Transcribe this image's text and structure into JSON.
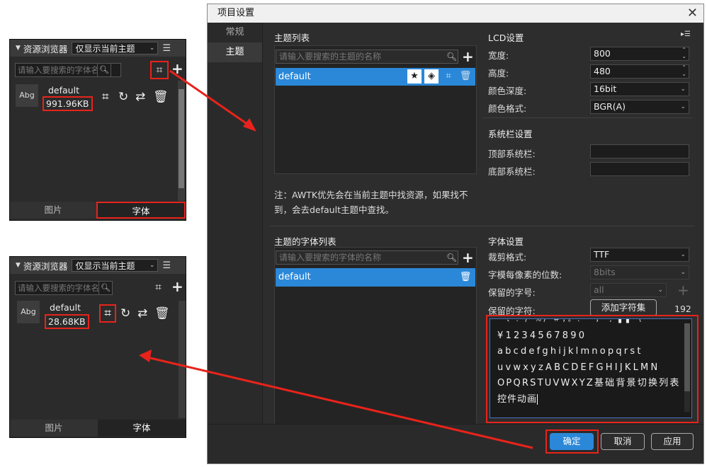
{
  "panel_top": {
    "title": "资源浏览器",
    "filter_select": "仅显示当前主题",
    "search_placeholder": "请输入要搜索的字体名称",
    "item": {
      "thumb": "Abg",
      "name": "default",
      "size": "991.96KB"
    },
    "tabs": [
      "图片",
      "字体"
    ],
    "active_tab": "字体"
  },
  "panel_bottom": {
    "title": "资源浏览器",
    "filter_select": "仅显示当前主题",
    "search_placeholder": "请输入要搜索的字体名称",
    "item": {
      "thumb": "Abg",
      "name": "default",
      "size": "28.68KB"
    },
    "tabs": [
      "图片",
      "字体"
    ],
    "active_tab": "字体"
  },
  "dialog": {
    "title": "项目设置",
    "nav": [
      "常规",
      "主题"
    ],
    "active_nav": "主题",
    "theme_list": {
      "title": "主题列表",
      "search_placeholder": "请输入要搜索的主题的名称",
      "items": [
        "default"
      ]
    },
    "note": "注：AWTK优先会在当前主题中找资源，如果找不到，会去default主题中查找。",
    "lcd": {
      "title": "LCD设置",
      "width_label": "宽度:",
      "width": "800",
      "height_label": "高度:",
      "height": "480",
      "depth_label": "颜色深度:",
      "depth": "16bit",
      "format_label": "颜色格式:",
      "format": "BGR(A)"
    },
    "system_bar": {
      "title": "系统栏设置",
      "top_label": "顶部系统栏:",
      "top": "",
      "bottom_label": "底部系统栏:",
      "bottom": ""
    },
    "font_list": {
      "title": "主题的字体列表",
      "search_placeholder": "请输入要搜索的字体的名称",
      "items": [
        "default"
      ]
    },
    "font_settings": {
      "title": "字体设置",
      "clip_label": "裁剪格式:",
      "clip": "TTF",
      "bpp_label": "字模每像素的位数:",
      "bpp": "8bits",
      "reserved_size_label": "保留的字号:",
      "reserved_size": "all",
      "reserved_chars_label": "保留的字符:",
      "add_charset": "添加字符集",
      "char_count": "192",
      "chars_lines": [
        "一、: /  ％/ ＃，。:  ·           ，  , ▌▌ \\",
        "¥1234567890",
        "abcdefghijklmnopqrst",
        "uvwxyzABCDEFGHIJKLMN",
        "OPQRSTUVWXYZ基础背景切换列表",
        "控件动画"
      ]
    },
    "buttons": {
      "ok": "确定",
      "cancel": "取消",
      "apply": "应用"
    }
  },
  "colors": {
    "accent": "#2b88d8",
    "highlight": "#e8231b",
    "panel_bg": "#2b2b2b"
  }
}
